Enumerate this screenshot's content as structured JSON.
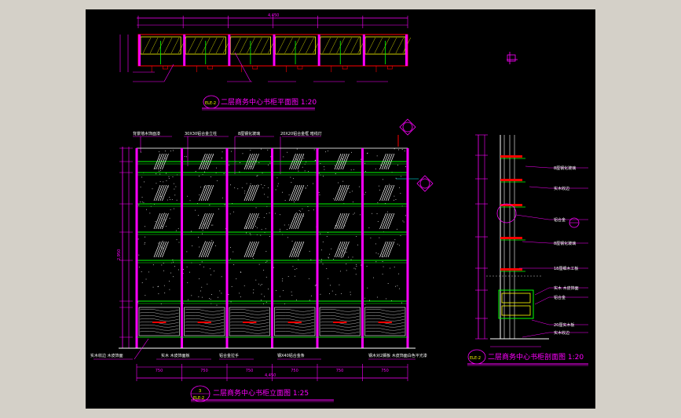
{
  "colors": {
    "background": "#000000",
    "frame": "#d4d0c8",
    "magenta": "#ff00ff",
    "green": "#00ff00",
    "white": "#ffffff",
    "yellow": "#ffff00",
    "cyan": "#00ffff",
    "red": "#ff0000"
  },
  "titles": {
    "plan": "二层商务中心书柜平面图 1:20",
    "elevation": "二层商务中心书柜立面图 1:25",
    "section": "二层商务中心书柜剖面图 1:20"
  },
  "tags": {
    "plan": "ELE-2",
    "elevation_num": "3",
    "elevation": "ELE-2",
    "section": "ELE-2"
  },
  "elevation_annotations": [
    "背景墙木饰面漆",
    "30X30铝合金立柱",
    "8厘钢化玻璃",
    "20X20铝合金框 暗线灯",
    "实木收边 木皮饰面",
    "实木 木皮饰面板",
    "铝合金拉手",
    "钢X40铝合金条",
    "钢木对2搁板 木皮饰面白色平光漆"
  ],
  "section_annotations": [
    "8厘钢化玻璃",
    "实木收边",
    "铝合金",
    "8厘钢化玻璃",
    "18厘细木工板",
    "实木 木皮饰面",
    "铝合金",
    "20厘实木板",
    "实木收边"
  ],
  "dimensions": {
    "elevation_total": "4,450",
    "plan_total": "4,450",
    "bay": "750",
    "elevation_height": "2,950"
  }
}
